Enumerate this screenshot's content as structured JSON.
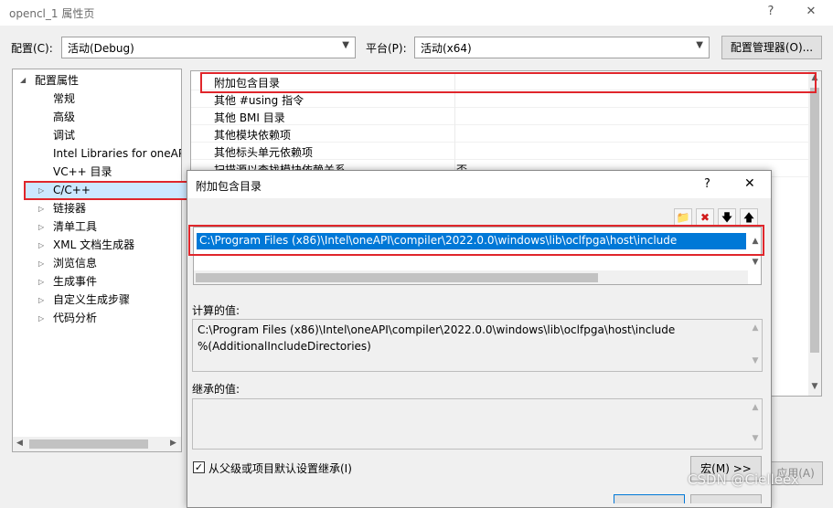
{
  "window": {
    "title": "opencl_1 属性页",
    "help_glyph": "?",
    "close_glyph": "✕"
  },
  "toolbar": {
    "config_label": "配置(C):",
    "config_value": "活动(Debug)",
    "platform_label": "平台(P):",
    "platform_value": "活动(x64)",
    "config_manager_label": "配置管理器(O)..."
  },
  "tree": {
    "root_label": "配置属性",
    "items": [
      {
        "label": "常规",
        "expandable": false
      },
      {
        "label": "高级",
        "expandable": false
      },
      {
        "label": "调试",
        "expandable": false
      },
      {
        "label": "Intel Libraries for oneAPI",
        "expandable": false
      },
      {
        "label": "VC++ 目录",
        "expandable": false
      },
      {
        "label": "C/C++",
        "expandable": true
      },
      {
        "label": "链接器",
        "expandable": true
      },
      {
        "label": "清单工具",
        "expandable": true
      },
      {
        "label": "XML 文档生成器",
        "expandable": true
      },
      {
        "label": "浏览信息",
        "expandable": true
      },
      {
        "label": "生成事件",
        "expandable": true
      },
      {
        "label": "自定义生成步骤",
        "expandable": true
      },
      {
        "label": "代码分析",
        "expandable": true
      }
    ]
  },
  "grid": {
    "rows": [
      {
        "name": "附加包含目录",
        "value": ""
      },
      {
        "name": "其他 #using 指令",
        "value": ""
      },
      {
        "name": "其他 BMI 目录",
        "value": ""
      },
      {
        "name": "其他模块依赖项",
        "value": ""
      },
      {
        "name": "其他标头单元依赖项",
        "value": ""
      },
      {
        "name": "扫描源以查找模块依赖关系",
        "value": "否"
      }
    ]
  },
  "dialog": {
    "title": "附加包含目录",
    "help_glyph": "?",
    "close_glyph": "✕",
    "entries": [
      "C:\\Program Files (x86)\\Intel\\oneAPI\\compiler\\2022.0.0\\windows\\lib\\oclfpga\\host\\include"
    ],
    "computed_label": "计算的值:",
    "computed_lines": [
      "C:\\Program Files (x86)\\Intel\\oneAPI\\compiler\\2022.0.0\\windows\\lib\\oclfpga\\host\\include",
      "%(AdditionalIncludeDirectories)"
    ],
    "inherited_label": "继承的值:",
    "inherit_checkbox_label": "从父级或项目默认设置继承(I)",
    "inherit_checked": true,
    "macro_button_label": "宏(M) >>"
  },
  "background": {
    "apply_label": "应用(A)"
  },
  "watermark": "CSDN @Cielleex",
  "colors": {
    "highlight_red": "#e0262b",
    "selection_blue": "#0078d7"
  }
}
